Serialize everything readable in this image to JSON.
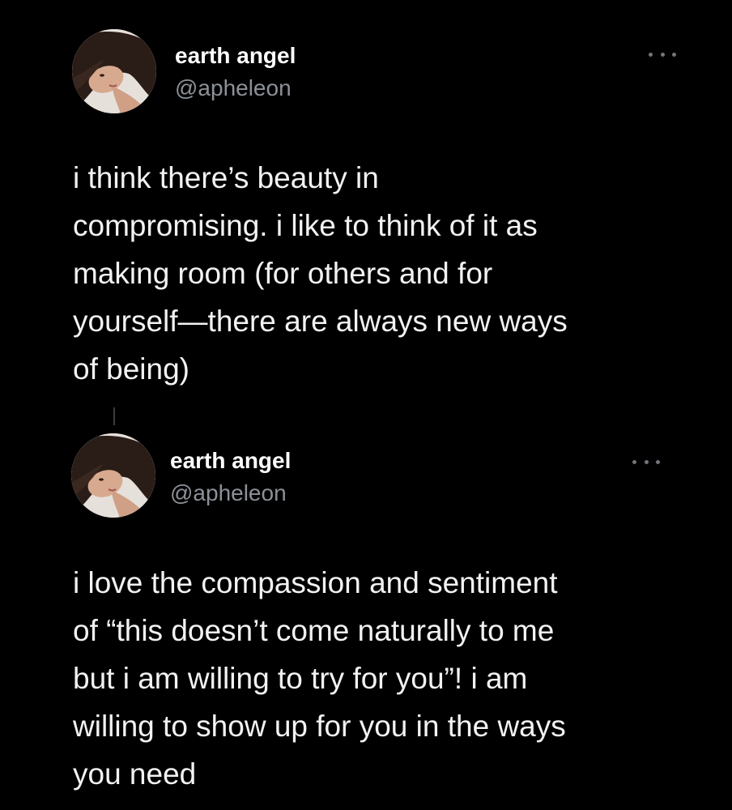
{
  "tweets": [
    {
      "author": {
        "name": "earth angel",
        "handle": "@apheleon"
      },
      "text": "i think there’s beauty in\ncompromising. i like to think of it as\nmaking room (for others and for\nyourself—there are always new ways\nof being)"
    },
    {
      "author": {
        "name": "earth angel",
        "handle": "@apheleon"
      },
      "text": "i love the compassion and sentiment\nof “this doesn’t come naturally to me\nbut i am willing to try for you”! i am\nwilling to show up for you in the ways\nyou need"
    }
  ],
  "colors": {
    "background": "#000000",
    "name": "#ffffff",
    "handle": "#8b9197",
    "body": "#f2f2f2"
  },
  "icons": {
    "more": "more-horizontal-icon",
    "avatar": "profile-photo"
  }
}
